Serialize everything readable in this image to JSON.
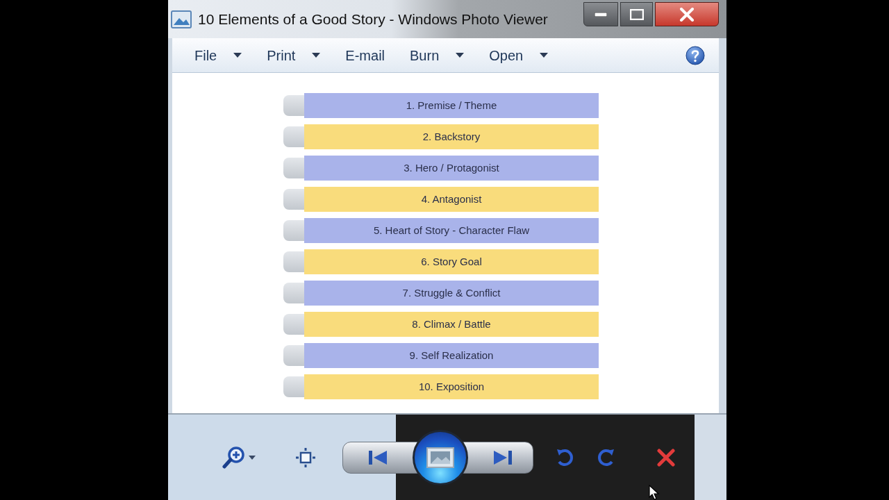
{
  "window": {
    "title": "10 Elements of a Good Story - Windows Photo Viewer"
  },
  "menu": [
    {
      "label": "File",
      "dropdown": true
    },
    {
      "label": "Print",
      "dropdown": true
    },
    {
      "label": "E-mail",
      "dropdown": false
    },
    {
      "label": "Burn",
      "dropdown": true
    },
    {
      "label": "Open",
      "dropdown": true
    }
  ],
  "photo": {
    "items": [
      {
        "label": "1. Premise / Theme",
        "color": "#a9b3ea"
      },
      {
        "label": "2. Backstory",
        "color": "#f9dc7c"
      },
      {
        "label": "3. Hero / Protagonist",
        "color": "#a9b3ea"
      },
      {
        "label": "4. Antagonist",
        "color": "#f9dc7c"
      },
      {
        "label": "5. Heart of Story - Character Flaw",
        "color": "#a9b3ea"
      },
      {
        "label": "6. Story Goal",
        "color": "#f9dc7c"
      },
      {
        "label": "7. Struggle & Conflict",
        "color": "#a9b3ea"
      },
      {
        "label": "8. Climax / Battle",
        "color": "#f9dc7c"
      },
      {
        "label": "9. Self Realization",
        "color": "#a9b3ea"
      },
      {
        "label": "10. Exposition",
        "color": "#f9dc7c"
      }
    ]
  }
}
